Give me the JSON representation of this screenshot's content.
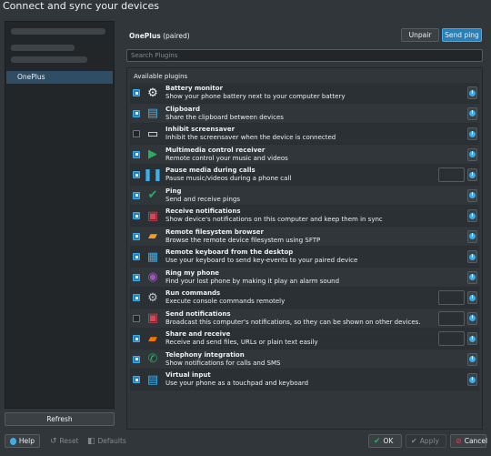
{
  "window": {
    "title": "Connect and sync your devices"
  },
  "devices": {
    "selected": "OnePlus"
  },
  "refresh_label": "Refresh",
  "header": {
    "device_name": "OnePlus",
    "device_status": "(paired)",
    "unpair_label": "Unpair",
    "ping_label": "Send ping"
  },
  "search": {
    "placeholder": "Search Plugins"
  },
  "plugins_title": "Available plugins",
  "plugins": [
    {
      "name": "Battery monitor",
      "desc": "Show your phone battery next to your computer battery",
      "checked": true,
      "icon": "gear-icon",
      "configurable": false
    },
    {
      "name": "Clipboard",
      "desc": "Share the clipboard between devices",
      "checked": true,
      "icon": "clipboard-icon",
      "configurable": false
    },
    {
      "name": "Inhibit screensaver",
      "desc": "Inhibit the screensaver when the device is connected",
      "checked": false,
      "icon": "monitor-icon",
      "configurable": false
    },
    {
      "name": "Multimedia control receiver",
      "desc": "Remote control your music and videos",
      "checked": true,
      "icon": "play-icon",
      "configurable": false
    },
    {
      "name": "Pause media during calls",
      "desc": "Pause music/videos during a phone call",
      "checked": true,
      "icon": "pause-icon",
      "configurable": true
    },
    {
      "name": "Ping",
      "desc": "Send and receive pings",
      "checked": true,
      "icon": "checkmark-icon",
      "configurable": false
    },
    {
      "name": "Receive notifications",
      "desc": "Show device's notifications on this computer and keep them in sync",
      "checked": true,
      "icon": "notification-icon",
      "configurable": false
    },
    {
      "name": "Remote filesystem browser",
      "desc": "Browse the remote device filesystem using SFTP",
      "checked": true,
      "icon": "folder-icon",
      "configurable": false
    },
    {
      "name": "Remote keyboard from the desktop",
      "desc": "Use your keyboard to send key-events to your paired device",
      "checked": true,
      "icon": "keyboard-icon",
      "configurable": false
    },
    {
      "name": "Ring my phone",
      "desc": "Find your lost phone by making it play an alarm sound",
      "checked": true,
      "icon": "bell-icon",
      "configurable": false
    },
    {
      "name": "Run commands",
      "desc": "Execute console commands remotely",
      "checked": true,
      "icon": "gears-icon",
      "configurable": true
    },
    {
      "name": "Send notifications",
      "desc": "Broadcast this computer's notifications, so they can be shown on other devices.",
      "checked": false,
      "icon": "notification-icon",
      "configurable": true
    },
    {
      "name": "Share and receive",
      "desc": "Receive and send files, URLs or plain text easily",
      "checked": true,
      "icon": "folder-share-icon",
      "configurable": true
    },
    {
      "name": "Telephony integration",
      "desc": "Show notifications for calls and SMS",
      "checked": true,
      "icon": "phone-icon",
      "configurable": false
    },
    {
      "name": "Virtual input",
      "desc": "Use your phone as a touchpad and keyboard",
      "checked": true,
      "icon": "clipboard-icon",
      "configurable": false
    }
  ],
  "footer": {
    "help_label": "Help",
    "reset_label": "Reset",
    "defaults_label": "Defaults",
    "ok_label": "OK",
    "apply_label": "Apply",
    "cancel_label": "Cancel"
  }
}
